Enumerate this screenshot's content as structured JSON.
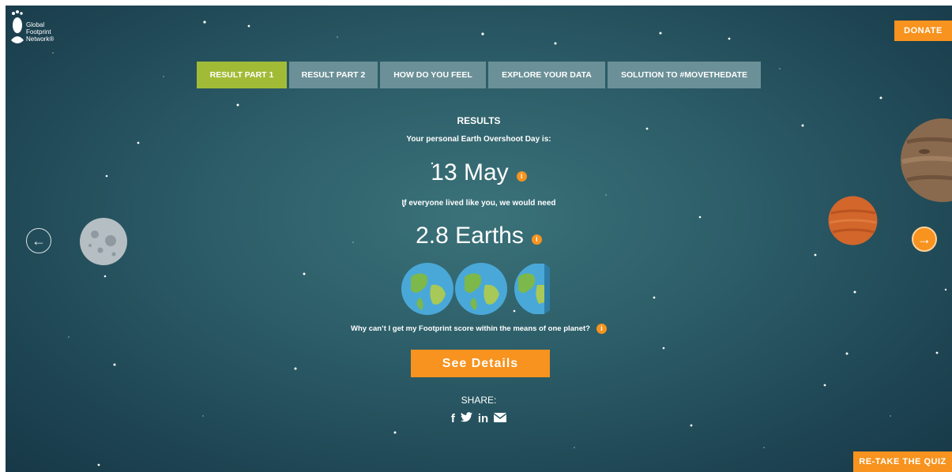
{
  "logo": {
    "lines": [
      "Global",
      "Footprint",
      "Network®"
    ]
  },
  "header": {
    "donate_label": "DONATE"
  },
  "tabs": [
    {
      "label": "RESULT PART 1",
      "active": true
    },
    {
      "label": "RESULT PART 2",
      "active": false
    },
    {
      "label": "HOW DO YOU FEEL",
      "active": false
    },
    {
      "label": "EXPLORE YOUR DATA",
      "active": false
    },
    {
      "label": "SOLUTION TO #MOVETHEDATE",
      "active": false
    }
  ],
  "results": {
    "title": "RESULTS",
    "subtitle": "Your personal Earth Overshoot Day is:",
    "date": "13 May",
    "needs_text": "If everyone lived like you, we would need",
    "earths": "2.8 Earths",
    "earth_count": 2.8,
    "info_glyph": "i",
    "why_text": "Why can’t I get my Footprint score within the means of one planet?",
    "details_label": "See Details"
  },
  "share": {
    "label": "SHARE:",
    "icons": [
      "facebook-icon",
      "twitter-icon",
      "linkedin-icon",
      "email-icon"
    ]
  },
  "nav": {
    "prev_icon": "arrow-left-icon",
    "next_icon": "arrow-right-icon"
  },
  "footer": {
    "retake_label": "RE-TAKE THE QUIZ"
  },
  "colors": {
    "accent_orange": "#f7931e",
    "active_tab": "#a2bb37",
    "inactive_tab": "#6b9097",
    "background": "#2c5d68"
  }
}
